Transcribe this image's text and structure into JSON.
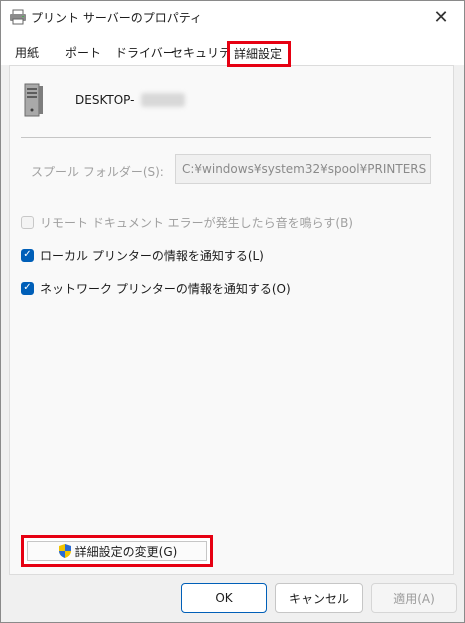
{
  "window": {
    "title": "プリント サーバーのプロパティ",
    "close_icon": "close-icon"
  },
  "tabs": [
    {
      "label": "用紙"
    },
    {
      "label": "ポート"
    },
    {
      "label": "ドライバー"
    },
    {
      "label": "セキュリティ"
    },
    {
      "label": "詳細設定",
      "active": true
    }
  ],
  "server": {
    "name": "DESKTOP-",
    "icon": "server-icon"
  },
  "spool": {
    "label": "スプール フォルダー(S):",
    "value": "C:¥windows¥system32¥spool¥PRINTERS"
  },
  "options": [
    {
      "label": "リモート ドキュメント エラーが発生したら音を鳴らす(B)",
      "checked": false,
      "disabled": true
    },
    {
      "label": "ローカル プリンターの情報を通知する(L)",
      "checked": true,
      "disabled": false
    },
    {
      "label": "ネットワーク プリンターの情報を通知する(O)",
      "checked": true,
      "disabled": false
    }
  ],
  "advanced_button": {
    "label": "詳細設定の変更(G)",
    "icon": "uac-shield-icon"
  },
  "footer": {
    "ok": "OK",
    "cancel": "キャンセル",
    "apply": "適用(A)"
  },
  "colors": {
    "accent": "#005fb8",
    "highlight": "#e60012"
  }
}
